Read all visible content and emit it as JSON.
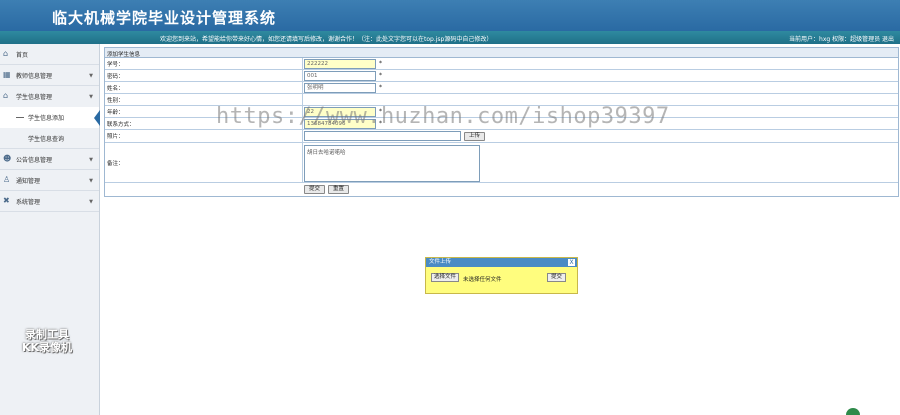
{
  "header": {
    "title": "临大机械学院毕业设计管理系统"
  },
  "subbar": {
    "welcome": "欢迎您到来站，希望能给你带来好心情，如您还请填写后修改，谢谢合作！（注：此处文字您可以在top.jsp源码中自己修改）",
    "user": "当前用户：hxg 权限：超级管理员 退出"
  },
  "sidebar": {
    "items": [
      {
        "label": "首页",
        "icon": "home-icon"
      },
      {
        "label": "教师信息管理",
        "icon": "grid-icon"
      },
      {
        "label": "学生信息管理",
        "icon": "home-icon"
      },
      {
        "label": "公告信息管理",
        "icon": "user-icon"
      },
      {
        "label": "通知管理",
        "icon": "person-icon"
      },
      {
        "label": "系统管理",
        "icon": "tools-icon"
      }
    ],
    "sub_items": [
      "学生信息添加",
      "学生信息查询"
    ],
    "watermark_line1": "录制工具",
    "watermark_line2": "KK录像机"
  },
  "form": {
    "caption": "添加学生信息",
    "fields": {
      "student_no": {
        "label": "学号：",
        "value": "222222"
      },
      "password": {
        "label": "密码：",
        "value": "001"
      },
      "name": {
        "label": "姓名：",
        "value": "张明明"
      },
      "gender": {
        "label": "性别：",
        "value": ""
      },
      "age": {
        "label": "年龄：",
        "value": "22"
      },
      "phone": {
        "label": "联系方式：",
        "value": "13684784096"
      },
      "photo": {
        "label": "照片：",
        "value": "",
        "upload_label": "上传"
      },
      "remark": {
        "label": "备注：",
        "value": "胡日去哈诺喏哈"
      }
    },
    "required_mark": "*",
    "submit_label": "提交",
    "reset_label": "重置"
  },
  "watermark_text": "https://www.huzhan.com/ishop39397",
  "upload_dialog": {
    "title": "文件上传",
    "close": "X",
    "choose_label": "选择文件",
    "no_file": "未选择任何文件",
    "submit_label": "提交"
  },
  "colors": {
    "header": "#2a6aa3",
    "subbar": "#1f7088",
    "dialog": "#fffd7e"
  }
}
